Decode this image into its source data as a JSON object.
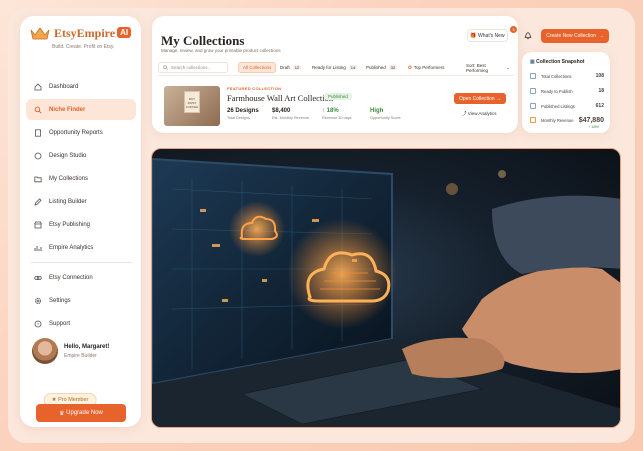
{
  "app": {
    "brand": "EtsyEmpire",
    "brand_suffix": "AI",
    "tagline": "Build. Create. Profit on Etsy."
  },
  "sidebar": {
    "items": [
      {
        "label": "Dashboard",
        "icon": "home-icon"
      },
      {
        "label": "Niche Finder",
        "icon": "search-icon",
        "active": true
      },
      {
        "label": "Opportunity Reports",
        "icon": "file-icon"
      },
      {
        "label": "Design Studio",
        "icon": "palette-icon"
      },
      {
        "label": "My Collections",
        "icon": "folder-icon"
      },
      {
        "label": "Listing Builder",
        "icon": "pencil-icon"
      },
      {
        "label": "Etsy Publishing",
        "icon": "shop-icon"
      },
      {
        "label": "Empire Analytics",
        "icon": "chart-icon"
      }
    ],
    "secondary": [
      {
        "label": "Etsy Connection",
        "icon": "link-icon"
      },
      {
        "label": "Settings",
        "icon": "gear-icon"
      },
      {
        "label": "Support",
        "icon": "help-icon"
      }
    ],
    "profile": {
      "greeting": "Hello, Margaret!",
      "role": "Empire Builder"
    },
    "pro_badge": "Pro Member",
    "upgrade_label": "Upgrade Now"
  },
  "header": {
    "title": "My Collections",
    "subtitle": "Manage, review, and grow your printable product collections",
    "whats_new": "What's New",
    "notif_count": "3",
    "create_label": "Create New Collection"
  },
  "filters": {
    "search_placeholder": "Search collections...",
    "chips": [
      {
        "label": "All Collections",
        "count": ""
      },
      {
        "label": "Draft",
        "count": "12"
      },
      {
        "label": "Ready for Listing",
        "count": "14"
      },
      {
        "label": "Published",
        "count": "32"
      },
      {
        "label": "Top Performers",
        "count": ""
      }
    ],
    "sort": "Sort: Best Performing"
  },
  "collection": {
    "featured_tag": "FEATURED COLLECTION",
    "name": "Farmhouse Wall Art Collection",
    "status": "Published",
    "thumb_text": "BUT FIRST COFFEE",
    "stats": [
      {
        "value": "26 Designs",
        "label": "Total Designs"
      },
      {
        "value": "$8,400",
        "label": "Est. Monthly Revenue"
      },
      {
        "value": "↑ 18%",
        "label": "Revenue 30 days"
      },
      {
        "value": "High",
        "label": "Opportunity Score"
      }
    ],
    "open_label": "Open Collection",
    "analytics_label": "View Analytics"
  },
  "snapshot": {
    "title": "Collection Snapshot",
    "rows": [
      {
        "label": "Total Collections",
        "value": "108"
      },
      {
        "label": "Ready to Publish",
        "value": "18"
      },
      {
        "label": "Published Listings",
        "value": "612"
      },
      {
        "label": "Monthly Revenue",
        "value": "$47,880"
      }
    ],
    "footer": "↑ 18%"
  },
  "colors": {
    "accent": "#e8622b",
    "accent_soft": "#fde6d8",
    "success": "#3f8a3f"
  }
}
